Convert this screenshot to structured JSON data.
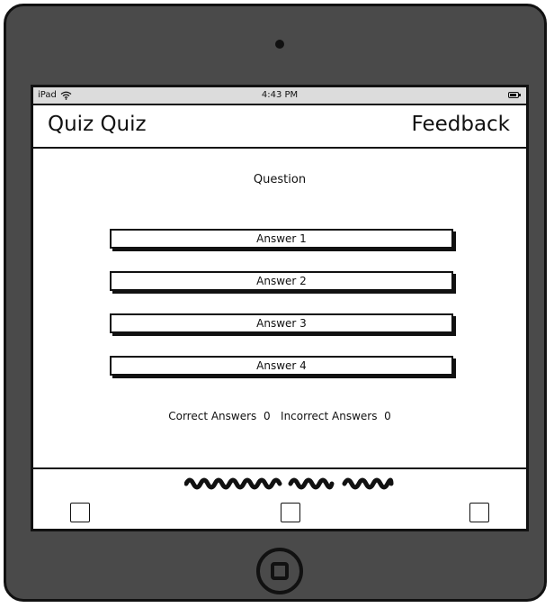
{
  "status_bar": {
    "carrier": "iPad",
    "time": "4:43 PM"
  },
  "nav": {
    "title": "Quiz Quiz",
    "feedback_label": "Feedback"
  },
  "question": "Question",
  "answers": [
    {
      "label": "Answer 1"
    },
    {
      "label": "Answer 2"
    },
    {
      "label": "Answer 3"
    },
    {
      "label": "Answer 4"
    }
  ],
  "score": {
    "correct_label": "Correct Answers",
    "correct_value": "0",
    "incorrect_label": "Incorrect Answers",
    "incorrect_value": "0"
  },
  "icons": {
    "wifi": "wifi-icon",
    "battery": "battery-icon",
    "home": "home-button-icon",
    "tabs": [
      "tab-icon",
      "tab-icon",
      "tab-icon"
    ]
  }
}
